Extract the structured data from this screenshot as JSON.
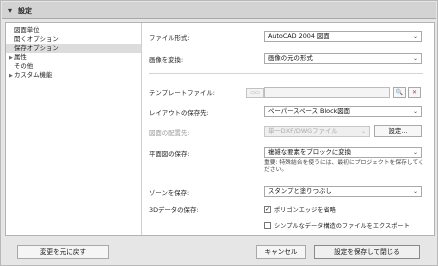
{
  "window": {
    "title": "設定"
  },
  "tree": {
    "items": [
      {
        "label": "図面単位",
        "indent": 1,
        "expandable": false,
        "selected": false
      },
      {
        "label": "開くオプション",
        "indent": 1,
        "expandable": false,
        "selected": false
      },
      {
        "label": "保存オプション",
        "indent": 1,
        "expandable": false,
        "selected": true
      },
      {
        "label": "属性",
        "indent": 0,
        "expandable": true,
        "selected": false
      },
      {
        "label": "その他",
        "indent": 0,
        "expandable": false,
        "selected": false
      },
      {
        "label": "カスタム機能",
        "indent": 0,
        "expandable": true,
        "selected": false
      }
    ]
  },
  "form": {
    "file_format_label": "ファイル形式:",
    "file_format_value": "AutoCAD 2004 図面",
    "convert_image_label": "画像を変換:",
    "convert_image_value": "画像の元の形式",
    "template_label": "テンプレートファイル:",
    "template_value": "",
    "layout_save_label": "レイアウトの保存先:",
    "layout_save_value": "ペーパースペース Block図面",
    "drawing_place_label": "図面の配置先:",
    "drawing_place_value": "単一DXF/DWGファイル",
    "settings_button": "設定...",
    "plan_save_label": "平面図の保存:",
    "plan_save_value": "複雑な要素をブロックに変換",
    "plan_save_note_1": "重要: 特殊結合を使うには、最初にプロジェクトを保存してく",
    "plan_save_note_2": "ださい。",
    "zone_save_label": "ゾーンを保存:",
    "zone_save_value": "スタンプと塗りつぶし",
    "data3d_label": "3Dデータの保存:",
    "polygon_edges_label": "ポリゴンエッジを省略",
    "polygon_edges_checked": true,
    "simple_data_label": "シンプルなデータ構造のファイルをエクスポート",
    "simple_data_checked": false
  },
  "footer": {
    "reset_button": "変更を元に戻す",
    "cancel_button": "キャンセル",
    "save_close_button": "設定を保存して閉じる"
  }
}
